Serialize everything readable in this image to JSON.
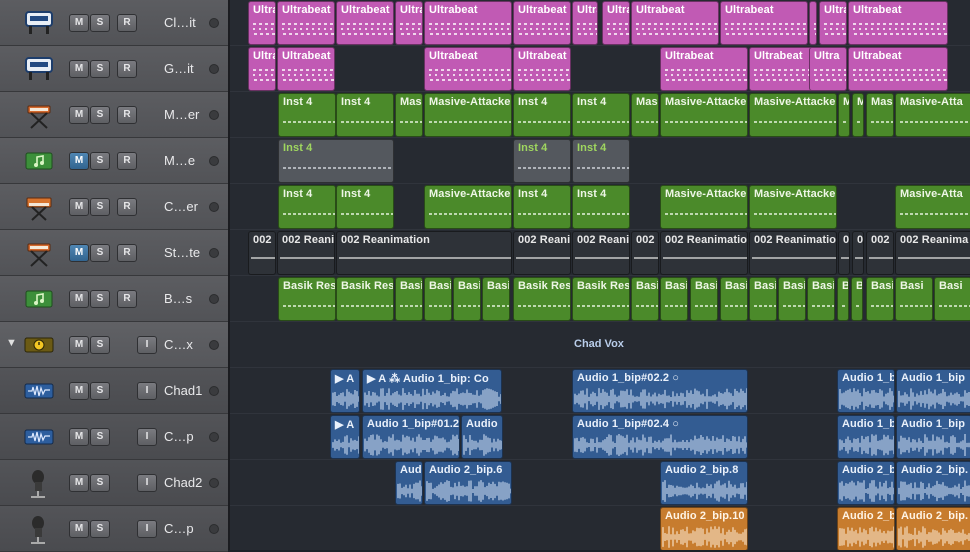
{
  "tracks": [
    {
      "name": "Cl…it",
      "icon": "drum-machine-icon",
      "buttons": [
        "M",
        "S",
        "R"
      ],
      "active": []
    },
    {
      "name": "G…it",
      "icon": "drum-machine-icon",
      "buttons": [
        "M",
        "S",
        "R"
      ],
      "active": []
    },
    {
      "name": "M…er",
      "icon": "keyboard-stand-icon",
      "buttons": [
        "M",
        "S",
        "R"
      ],
      "active": []
    },
    {
      "name": "M…e",
      "icon": "music-note-icon",
      "buttons": [
        "M",
        "S",
        "R"
      ],
      "active": [
        "M"
      ]
    },
    {
      "name": "C…er",
      "icon": "synth-icon",
      "buttons": [
        "M",
        "S",
        "R"
      ],
      "active": []
    },
    {
      "name": "St…te",
      "icon": "keyboard-stand-icon",
      "buttons": [
        "M",
        "S",
        "R"
      ],
      "active": [
        "M"
      ]
    },
    {
      "name": "B…s",
      "icon": "music-note-icon",
      "buttons": [
        "M",
        "S",
        "R"
      ],
      "active": []
    },
    {
      "name": "C…x",
      "icon": "track-stack-icon",
      "buttons": [
        "M",
        "S",
        "I"
      ],
      "active": [],
      "disclosure": "▼"
    },
    {
      "name": "Chad1",
      "icon": "audio-waveform-icon",
      "buttons": [
        "M",
        "S",
        "I"
      ],
      "active": []
    },
    {
      "name": "C…p",
      "icon": "audio-waveform-icon",
      "buttons": [
        "M",
        "S",
        "I"
      ],
      "active": []
    },
    {
      "name": "Chad2",
      "icon": "microphone-icon",
      "buttons": [
        "M",
        "S",
        "I"
      ],
      "active": []
    },
    {
      "name": "C…p",
      "icon": "microphone-icon",
      "buttons": [
        "M",
        "S",
        "I"
      ],
      "active": []
    }
  ],
  "stack_title": "Chad Vox",
  "lanes": [
    {
      "regions": [
        {
          "label": "Ultra",
          "style": "pink"
        },
        {
          "label": "Ultrabeat",
          "style": "pink"
        },
        {
          "label": "Ultrabeat",
          "style": "pink"
        },
        {
          "label": "Ultra",
          "style": "pink"
        },
        {
          "label": "Ultrabeat",
          "style": "pink"
        },
        {
          "label": "Ultrabeat",
          "style": "pink"
        },
        {
          "label": "Ultrabeat",
          "style": "pink"
        },
        {
          "label": "Ultra",
          "style": "pink"
        },
        {
          "label": "Ultrabeat",
          "style": "pink"
        },
        {
          "label": "Ultrabeat",
          "style": "pink"
        },
        {
          "label": "",
          "style": "pink"
        },
        {
          "label": "Ultra",
          "style": "pink"
        },
        {
          "label": "Ultrabeat",
          "style": "pink"
        }
      ]
    },
    {
      "regions": [
        {
          "label": "Ultra",
          "style": "pink"
        },
        {
          "label": "Ultrabeat",
          "style": "pink"
        },
        {
          "label": "Ultrabeat",
          "style": "pink"
        },
        {
          "label": "Ultrabeat",
          "style": "pink"
        },
        {
          "label": "Ultrabeat",
          "style": "pink"
        },
        {
          "label": "Ultrabeat",
          "style": "pink"
        },
        {
          "label": "Ultra",
          "style": "pink"
        },
        {
          "label": "Ultrabeat",
          "style": "pink"
        }
      ]
    },
    {
      "regions": [
        {
          "label": "Inst 4",
          "style": "green"
        },
        {
          "label": "Inst 4",
          "style": "green"
        },
        {
          "label": "Mas",
          "style": "green"
        },
        {
          "label": "Masive-Attacke",
          "style": "green"
        },
        {
          "label": "Inst 4",
          "style": "green"
        },
        {
          "label": "Inst 4",
          "style": "green"
        },
        {
          "label": "Mas",
          "style": "green"
        },
        {
          "label": "Masive-Attacke",
          "style": "green"
        },
        {
          "label": "Masive-Attacke",
          "style": "green"
        },
        {
          "label": "M",
          "style": "green"
        },
        {
          "label": "M",
          "style": "green"
        },
        {
          "label": "Mas",
          "style": "green"
        },
        {
          "label": "Masive-Atta",
          "style": "green"
        }
      ]
    },
    {
      "regions": [
        {
          "label": "Inst 4",
          "style": "gray"
        },
        {
          "label": "Inst 4",
          "style": "gray"
        },
        {
          "label": "Inst 4",
          "style": "gray"
        },
        {
          "label": "Inst 4",
          "style": "gray"
        }
      ]
    },
    {
      "regions": [
        {
          "label": "Inst 4",
          "style": "green"
        },
        {
          "label": "Inst 4",
          "style": "green"
        },
        {
          "label": "Masive-Attacke",
          "style": "green"
        },
        {
          "label": "Inst 4",
          "style": "green"
        },
        {
          "label": "Inst 4",
          "style": "green"
        },
        {
          "label": "Masive-Attacke",
          "style": "green"
        },
        {
          "label": "Masive-Attacke",
          "style": "green"
        },
        {
          "label": "Masive-Atta",
          "style": "green"
        }
      ]
    },
    {
      "regions": [
        {
          "label": "002 Re",
          "style": "dark"
        },
        {
          "label": "002 Reani",
          "style": "dark"
        },
        {
          "label": "002 Reanimation",
          "style": "dark"
        },
        {
          "label": "002 Reani",
          "style": "dark"
        },
        {
          "label": "002 Reani",
          "style": "dark"
        },
        {
          "label": "002",
          "style": "dark"
        },
        {
          "label": "002 Reanimatio",
          "style": "dark"
        },
        {
          "label": "002 Reanimatio",
          "style": "dark"
        },
        {
          "label": "0",
          "style": "dark"
        },
        {
          "label": "0",
          "style": "dark"
        },
        {
          "label": "002",
          "style": "dark"
        },
        {
          "label": "002 Reanima",
          "style": "dark"
        }
      ]
    },
    {
      "regions": [
        {
          "label": "Basik Res",
          "style": "green"
        },
        {
          "label": "Basik Res",
          "style": "green"
        },
        {
          "label": "Basi",
          "style": "green"
        },
        {
          "label": "Basi",
          "style": "green"
        },
        {
          "label": "Basi",
          "style": "green"
        },
        {
          "label": "Basi",
          "style": "green"
        },
        {
          "label": "Basik Res",
          "style": "green"
        },
        {
          "label": "Basik Res",
          "style": "green"
        },
        {
          "label": "Basi",
          "style": "green"
        },
        {
          "label": "Basi",
          "style": "green"
        },
        {
          "label": "Basi",
          "style": "green"
        },
        {
          "label": "Basi",
          "style": "green"
        },
        {
          "label": "Basi",
          "style": "green"
        },
        {
          "label": "Basi",
          "style": "green"
        },
        {
          "label": "Basi",
          "style": "green"
        },
        {
          "label": "B",
          "style": "green"
        },
        {
          "label": "B",
          "style": "green"
        },
        {
          "label": "Basi",
          "style": "green"
        },
        {
          "label": "Basi",
          "style": "green"
        },
        {
          "label": "Basi",
          "style": "green"
        }
      ]
    },
    {
      "regions": []
    },
    {
      "regions": [
        {
          "label": "▶ A",
          "style": "blue"
        },
        {
          "label": "▶ A ⁂ Audio 1_bip: Co",
          "style": "blue"
        },
        {
          "label": "Audio 1_bip#02.2 ○",
          "style": "blue"
        },
        {
          "label": "Audio 1_b",
          "style": "blue"
        },
        {
          "label": "Audio 1_bip",
          "style": "blue"
        }
      ]
    },
    {
      "regions": [
        {
          "label": "▶ A",
          "style": "blue"
        },
        {
          "label": "Audio 1_bip#01.2",
          "style": "blue"
        },
        {
          "label": "Audio",
          "style": "blue"
        },
        {
          "label": "Audio 1_bip#02.4 ○",
          "style": "blue"
        },
        {
          "label": "Audio 1_b",
          "style": "blue"
        },
        {
          "label": "Audio 1_bip",
          "style": "blue"
        }
      ]
    },
    {
      "regions": [
        {
          "label": "Audi",
          "style": "blue"
        },
        {
          "label": "Audio 2_bip.6",
          "style": "blue"
        },
        {
          "label": "Audio 2_bip.8",
          "style": "blue"
        },
        {
          "label": "Audio 2_b",
          "style": "blue"
        },
        {
          "label": "Audio 2_bip.",
          "style": "blue"
        }
      ]
    },
    {
      "regions": [
        {
          "label": "Audio 2_bip.10",
          "style": "orange"
        },
        {
          "label": "Audio 2_b",
          "style": "orange"
        },
        {
          "label": "Audio 2_bip.",
          "style": "orange"
        }
      ]
    }
  ]
}
